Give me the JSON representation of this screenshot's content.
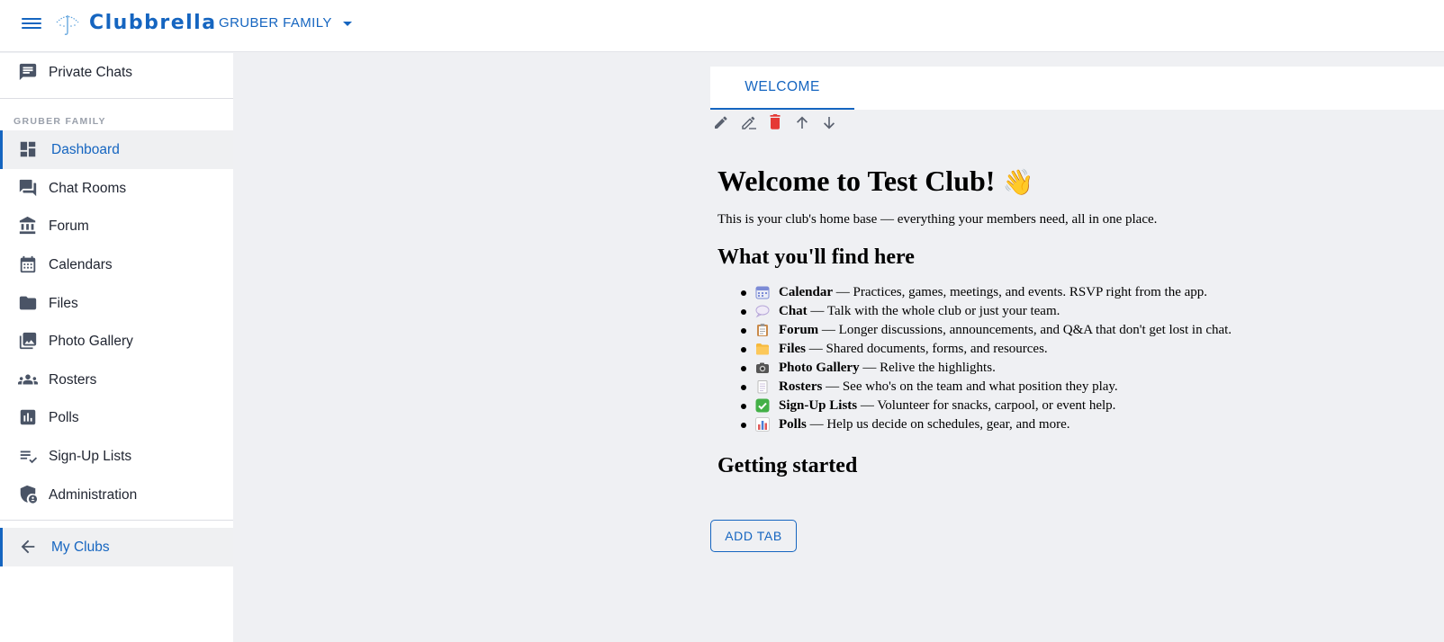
{
  "header": {
    "app_name": "Clubbrella",
    "club_selector": "GRUBER FAMILY"
  },
  "sidebar": {
    "top_item": {
      "label": "Private Chats",
      "icon": "chat-bubble-icon"
    },
    "section_label": "GRUBER FAMILY",
    "items": [
      {
        "label": "Dashboard",
        "icon": "dashboard-icon",
        "active": true
      },
      {
        "label": "Chat Rooms",
        "icon": "forum-chat-icon"
      },
      {
        "label": "Forum",
        "icon": "bank-icon"
      },
      {
        "label": "Calendars",
        "icon": "calendar-icon"
      },
      {
        "label": "Files",
        "icon": "folder-icon"
      },
      {
        "label": "Photo Gallery",
        "icon": "photo-library-icon"
      },
      {
        "label": "Rosters",
        "icon": "groups-icon"
      },
      {
        "label": "Polls",
        "icon": "poll-icon"
      },
      {
        "label": "Sign-Up Lists",
        "icon": "checklist-icon"
      },
      {
        "label": "Administration",
        "icon": "admin-shield-icon"
      }
    ],
    "bottom_item": {
      "label": "My Clubs",
      "icon": "arrow-back-icon"
    }
  },
  "tabs": [
    {
      "label": "WELCOME",
      "active": true
    }
  ],
  "toolbar_icons": [
    "edit-icon",
    "rename-icon",
    "delete-icon",
    "move-up-icon",
    "move-down-icon"
  ],
  "colors": {
    "accent": "#1565c0",
    "danger": "#e53935",
    "background": "#eff0f3"
  },
  "article": {
    "title": "Welcome to Test Club!",
    "title_emoji": "👋",
    "intro": "This is your club's home base — everything your members need, all in one place.",
    "section1_heading": "What you'll find here",
    "features": [
      {
        "name": "Calendar",
        "desc": " — Practices, games, meetings, and events. RSVP right from the app.",
        "icon": "calendar-emoji"
      },
      {
        "name": "Chat",
        "desc": " — Talk with the whole club or just your team.",
        "icon": "speech-bubble-emoji"
      },
      {
        "name": "Forum",
        "desc": " — Longer discussions, announcements, and Q&A that don't get lost in chat.",
        "icon": "clipboard-emoji"
      },
      {
        "name": "Files",
        "desc": " — Shared documents, forms, and resources.",
        "icon": "folder-emoji"
      },
      {
        "name": "Photo Gallery",
        "desc": " — Relive the highlights.",
        "icon": "camera-emoji"
      },
      {
        "name": "Rosters",
        "desc": " — See who's on the team and what position they play.",
        "icon": "notepad-emoji"
      },
      {
        "name": "Sign-Up Lists",
        "desc": " — Volunteer for snacks, carpool, or event help.",
        "icon": "check-mark-emoji"
      },
      {
        "name": "Polls",
        "desc": " — Help us decide on schedules, gear, and more.",
        "icon": "bar-chart-emoji"
      }
    ],
    "section2_heading": "Getting started"
  },
  "add_tab_label": "ADD TAB"
}
